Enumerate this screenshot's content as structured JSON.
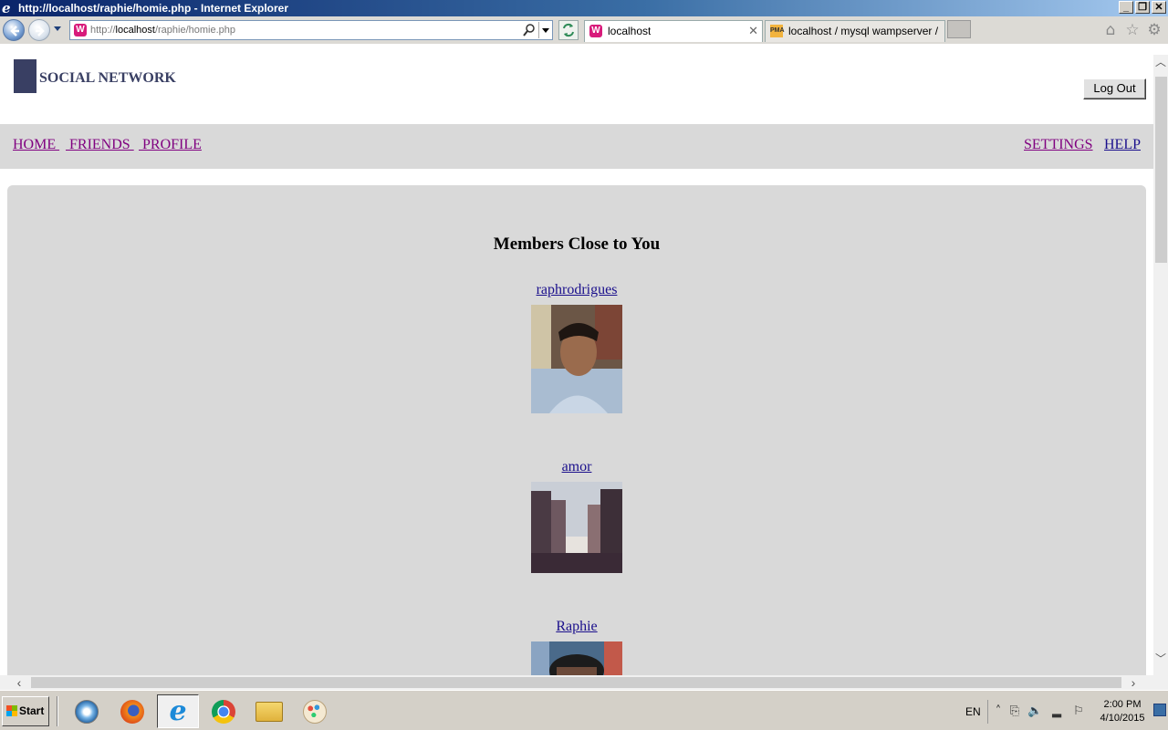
{
  "window": {
    "title": "http://localhost/raphie/homie.php - Internet Explorer",
    "controls": {
      "minimize": "_",
      "restore": "❐",
      "close": "✕"
    }
  },
  "browser": {
    "address": {
      "prefix": "http://",
      "host": "localhost",
      "path": "/raphie/homie.php"
    },
    "tabs": [
      {
        "label": "localhost",
        "close": "✕"
      },
      {
        "label": "localhost / mysql wampserver / ..."
      }
    ],
    "favicon_letter": "W",
    "pma_letter": "PMA"
  },
  "page": {
    "site_name": "SOCIAL NETWORK",
    "logout_label": "Log Out",
    "nav_left": [
      "HOME ",
      " FRIENDS ",
      " PROFILE"
    ],
    "nav_right": [
      "SETTINGS",
      "HELP"
    ],
    "section_title": "Members Close to You",
    "members": [
      {
        "name": "raphrodrigues"
      },
      {
        "name": "amor"
      },
      {
        "name": "Raphie"
      }
    ]
  },
  "taskbar": {
    "start_label": "Start",
    "language": "EN",
    "time": "2:00 PM",
    "date": "4/10/2015"
  },
  "colors": {
    "brand": "#393f63",
    "visited_link": "#800080",
    "link": "#1a0f8c",
    "panel": "#d9d9d9"
  }
}
